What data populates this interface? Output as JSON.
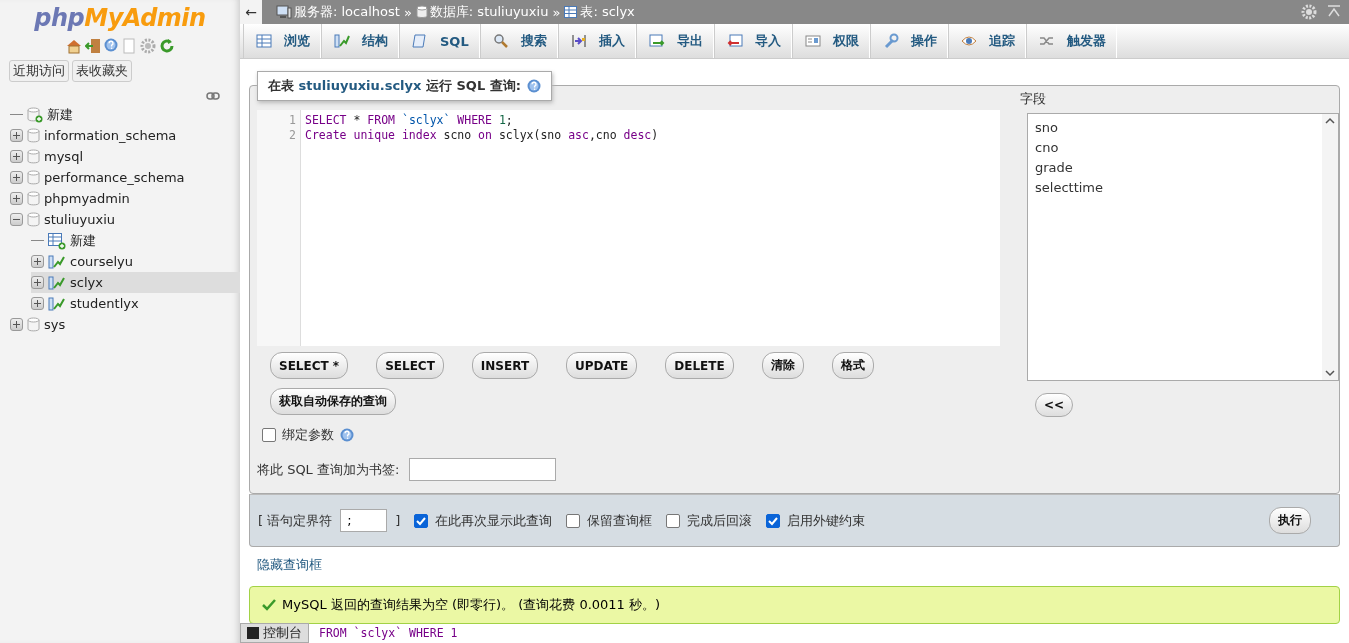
{
  "sidebar": {
    "logo": {
      "part1": "php",
      "part2": "MyAdmin"
    },
    "quick_tabs": [
      "近期访问",
      "表收藏夹"
    ],
    "tree": [
      {
        "label": "新建",
        "kind": "new-db",
        "selected": false
      },
      {
        "label": "information_schema",
        "kind": "db",
        "expanded": false,
        "selected": false
      },
      {
        "label": "mysql",
        "kind": "db",
        "expanded": false,
        "selected": false
      },
      {
        "label": "performance_schema",
        "kind": "db",
        "expanded": false,
        "selected": false
      },
      {
        "label": "phpmyadmin",
        "kind": "db",
        "expanded": false,
        "selected": false
      },
      {
        "label": "stuliuyuxiu",
        "kind": "db",
        "expanded": true,
        "selected": false,
        "children": [
          {
            "label": "新建",
            "kind": "new-table",
            "selected": false
          },
          {
            "label": "courselyu",
            "kind": "table",
            "expanded": false,
            "selected": false
          },
          {
            "label": "sclyx",
            "kind": "table",
            "expanded": false,
            "selected": true
          },
          {
            "label": "studentlyx",
            "kind": "table",
            "expanded": false,
            "selected": false
          }
        ]
      },
      {
        "label": "sys",
        "kind": "db",
        "expanded": false,
        "selected": false
      }
    ]
  },
  "top_bar": {
    "back": "←",
    "separator": "»",
    "crumbs": [
      {
        "label": "服务器: localhost",
        "kind": "server"
      },
      {
        "label": "数据库: stuliuyuxiu",
        "kind": "database"
      },
      {
        "label": "表: sclyx",
        "kind": "table"
      }
    ]
  },
  "tabs": [
    {
      "label": "浏览",
      "kind": "browse",
      "selected": false
    },
    {
      "label": "结构",
      "kind": "structure",
      "selected": false
    },
    {
      "label": "SQL",
      "kind": "sql",
      "selected": false
    },
    {
      "label": "搜索",
      "kind": "search",
      "selected": false
    },
    {
      "label": "插入",
      "kind": "insert",
      "selected": false
    },
    {
      "label": "导出",
      "kind": "export",
      "selected": false
    },
    {
      "label": "导入",
      "kind": "import",
      "selected": false
    },
    {
      "label": "权限",
      "kind": "privileges",
      "selected": false
    },
    {
      "label": "操作",
      "kind": "operations",
      "selected": false
    },
    {
      "label": "追踪",
      "kind": "tracking",
      "selected": false
    },
    {
      "label": "触发器",
      "kind": "triggers",
      "selected": false
    }
  ],
  "query_box": {
    "legend": {
      "prefix": "在表",
      "table": "stuliuyuxiu.sclyx",
      "suffix": "运行 SQL 查询:"
    },
    "code_lines": [
      {
        "number": "1",
        "tokens": [
          {
            "text": "SELECT",
            "kind": "keyword"
          },
          {
            "text": " * ",
            "kind": "plain"
          },
          {
            "text": "FROM",
            "kind": "keyword"
          },
          {
            "text": " `sclyx`",
            "kind": "string"
          },
          {
            "text": " WHERE",
            "kind": "keyword"
          },
          {
            "text": " 1",
            "kind": "number"
          },
          {
            "text": ";",
            "kind": "plain"
          }
        ]
      },
      {
        "number": "2",
        "tokens": [
          {
            "text": "Create",
            "kind": "keyword"
          },
          {
            "text": " unique",
            "kind": "keyword"
          },
          {
            "text": " index",
            "kind": "keyword"
          },
          {
            "text": " scno ",
            "kind": "plain"
          },
          {
            "text": "on",
            "kind": "keyword"
          },
          {
            "text": " sclyx(sno ",
            "kind": "plain"
          },
          {
            "text": "asc",
            "kind": "keyword"
          },
          {
            "text": ",cno ",
            "kind": "plain"
          },
          {
            "text": "desc",
            "kind": "keyword"
          },
          {
            "text": ")",
            "kind": "plain"
          }
        ]
      }
    ],
    "buttons": [
      "SELECT *",
      "SELECT",
      "INSERT",
      "UPDATE",
      "DELETE",
      "清除",
      "格式"
    ],
    "autosave_button": "获取自动保存的查询",
    "bind_params": {
      "label": "绑定参数",
      "checked": false
    },
    "bookmark_label": "将此 SQL 查询加为书签:",
    "fields_title": "字段",
    "fields": [
      "sno",
      "cno",
      "grade",
      "selecttime"
    ],
    "insert_field_button": "<<"
  },
  "options_bar": {
    "delimiter_label": "[ 语句定界符",
    "delimiter": ";",
    "delimiter_close": "]",
    "checkboxes": [
      {
        "label": "在此再次显示此查询",
        "checked": true
      },
      {
        "label": "保留查询框",
        "checked": false
      },
      {
        "label": "完成后回滚",
        "checked": false
      },
      {
        "label": "启用外键约束",
        "checked": true
      }
    ],
    "go_button": "执行"
  },
  "hide_link": "隐藏查询框",
  "message": "MySQL 返回的查询结果为空 (即零行)。 (查询花费 0.0011 秒。)",
  "console": {
    "label": "控制台",
    "peek": "FROM `sclyx` WHERE 1"
  }
}
